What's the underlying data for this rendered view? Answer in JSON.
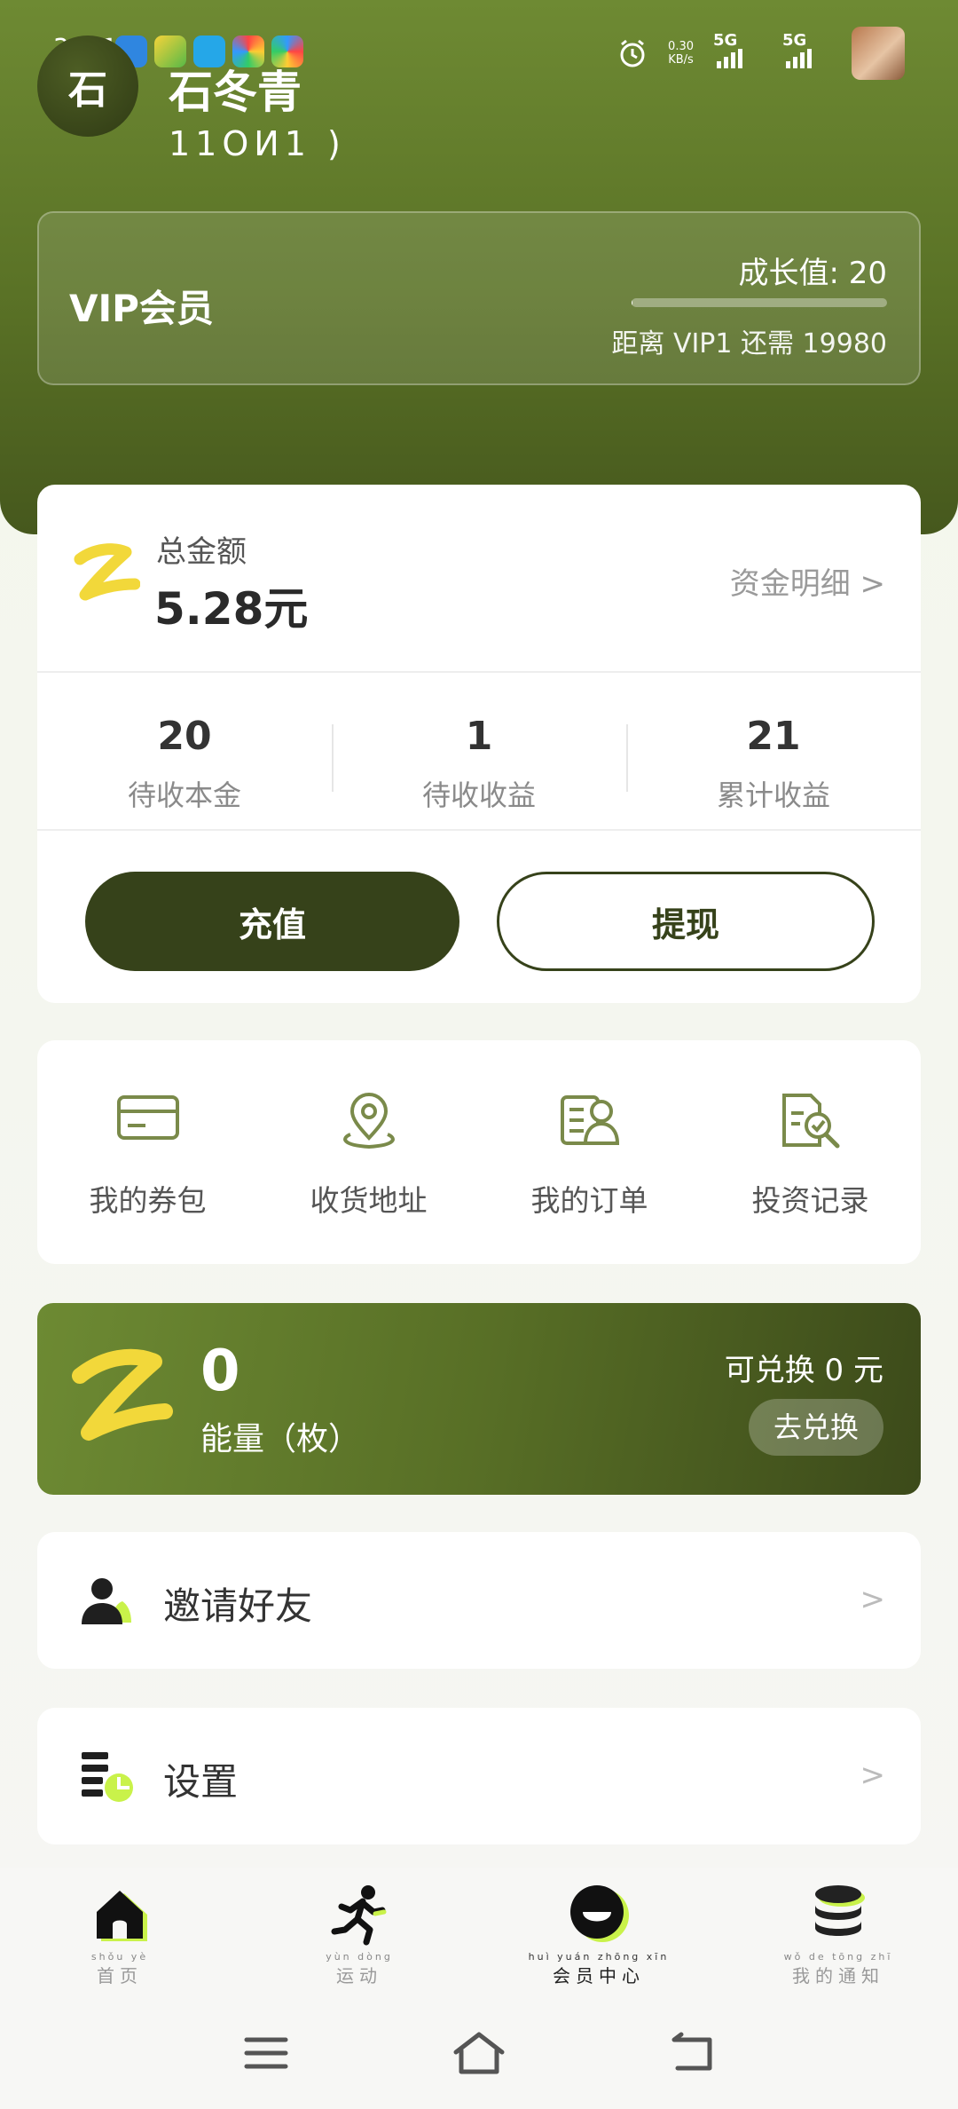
{
  "status_bar": {
    "time": "3:51",
    "net_speed_value": "0.30",
    "net_speed_unit": "KB/s",
    "sim1": "5G",
    "sim2": "5G"
  },
  "profile": {
    "avatar_char": "石",
    "name": "石冬青",
    "id_masked": "11ОИ1    )"
  },
  "vip": {
    "title": "VIP会员",
    "growth_label": "成长值: 20",
    "progress": 0.001,
    "remaining_text": "距离 VIP1 还需 19980"
  },
  "wallet": {
    "total_label": "总金额",
    "total_value": "5.28元",
    "detail_link": "资金明细 >",
    "stats": [
      {
        "value": "20",
        "label": "待收本金"
      },
      {
        "value": "1",
        "label": "待收收益"
      },
      {
        "value": "21",
        "label": "累计收益"
      }
    ],
    "recharge_label": "充值",
    "withdraw_label": "提现"
  },
  "quick_menu": [
    {
      "label": "我的券包",
      "icon": "coupon-card-icon"
    },
    {
      "label": "收货地址",
      "icon": "location-pin-icon"
    },
    {
      "label": "我的订单",
      "icon": "order-list-icon"
    },
    {
      "label": "投资记录",
      "icon": "document-search-icon"
    }
  ],
  "energy": {
    "value": "0",
    "label": "能量（枚）",
    "exchange_amount": "可兑换 0 元",
    "exchange_button": "去兑换"
  },
  "rows": [
    {
      "label": "邀请好友",
      "icon": "user-invite-icon",
      "arrow": ">"
    },
    {
      "label": "设置",
      "icon": "settings-list-icon",
      "arrow": ">"
    }
  ],
  "tabs": [
    {
      "pinyin": "shǒu  yè",
      "label": "首页",
      "icon": "home-icon",
      "active": false
    },
    {
      "pinyin": "yùn  dòng",
      "label": "运动",
      "icon": "runner-icon",
      "active": false
    },
    {
      "pinyin": "huì  yuán zhōng  xīn",
      "label": "会员中心",
      "icon": "member-face-icon",
      "active": true
    },
    {
      "pinyin": "wǒ  de  tōng  zhī",
      "label": "我的通知",
      "icon": "database-stack-icon",
      "active": false
    }
  ],
  "colors": {
    "header_green": "#5e7729",
    "dark_olive": "#36421a",
    "accent_yellow": "#f2d83a",
    "lime": "#c9f24a"
  }
}
